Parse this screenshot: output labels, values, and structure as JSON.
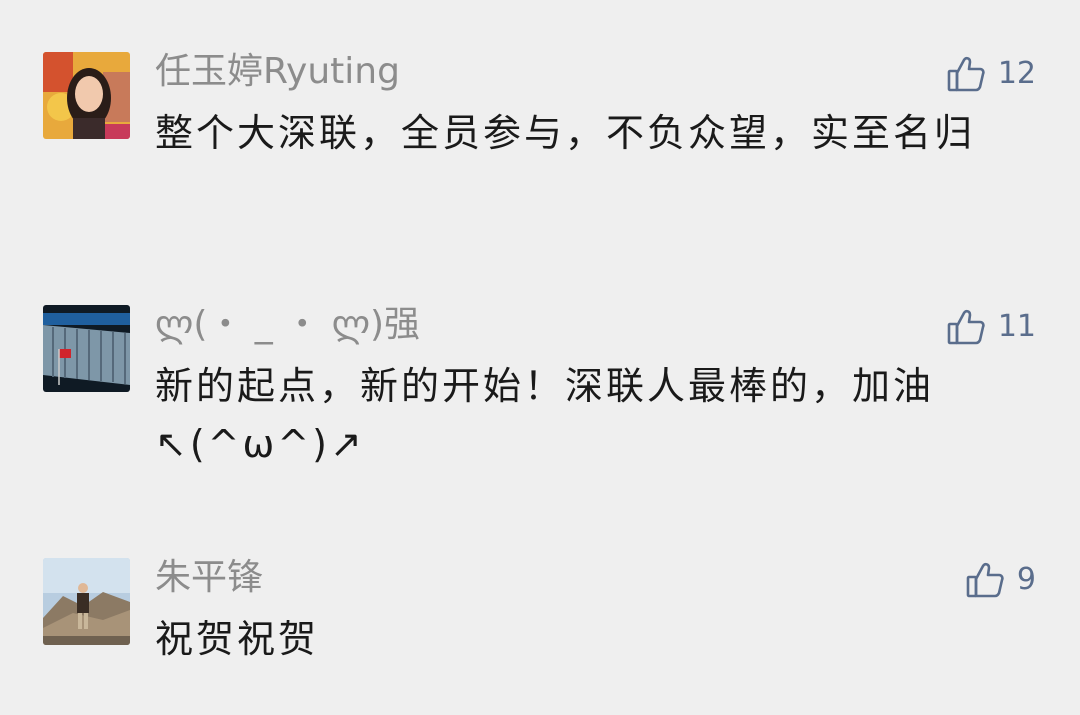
{
  "comments": [
    {
      "username": "任玉婷Ryuting",
      "text": "整个大深联，全员参与，不负众望，实至名归",
      "likes": "12",
      "avatar": "woman-portrait-avatar"
    },
    {
      "username": "ლ(・ _ ・ ლ)强",
      "text": "新的起点，新的开始！深联人最棒的，加油↖(^ω^)↗",
      "likes": "11",
      "avatar": "building-flag-avatar"
    },
    {
      "username": "朱平锋",
      "text": "祝贺祝贺",
      "likes": "9",
      "avatar": "great-wall-avatar"
    }
  ],
  "colors": {
    "background": "#efefef",
    "username": "#8c8c8c",
    "text": "#1a1a1a",
    "like": "#5a6d8c"
  }
}
